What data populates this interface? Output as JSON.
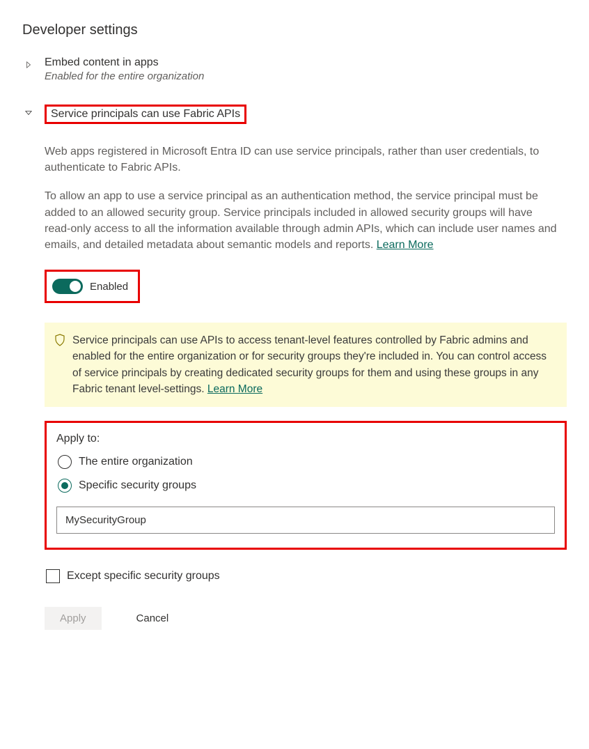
{
  "page_title": "Developer settings",
  "settings": {
    "embed": {
      "title": "Embed content in apps",
      "subtitle": "Enabled for the entire organization"
    },
    "service_principals": {
      "title": "Service principals can use Fabric APIs",
      "description1": "Web apps registered in Microsoft Entra ID can use service principals, rather than user credentials, to authenticate to Fabric APIs.",
      "description2": "To allow an app to use a service principal as an authentication method, the service principal must be added to an allowed security group. Service principals included in allowed security groups will have read-only access to all the information available through admin APIs, which can include user names and emails, and detailed metadata about semantic models and reports.  ",
      "learn_more": "Learn More",
      "toggle": {
        "enabled": true,
        "label": "Enabled"
      },
      "banner": {
        "text": "Service principals can use APIs to access tenant-level features controlled by Fabric admins and enabled for the entire organization or for security groups they're included in. You can control access of service principals by creating dedicated security groups for them and using these groups in any Fabric tenant level-settings.  ",
        "learn_more": "Learn More"
      },
      "apply": {
        "label": "Apply to:",
        "option_all": "The entire organization",
        "option_specific": "Specific security groups",
        "input_value": "MySecurityGroup"
      },
      "except_label": "Except specific security groups",
      "buttons": {
        "apply": "Apply",
        "cancel": "Cancel"
      }
    }
  }
}
